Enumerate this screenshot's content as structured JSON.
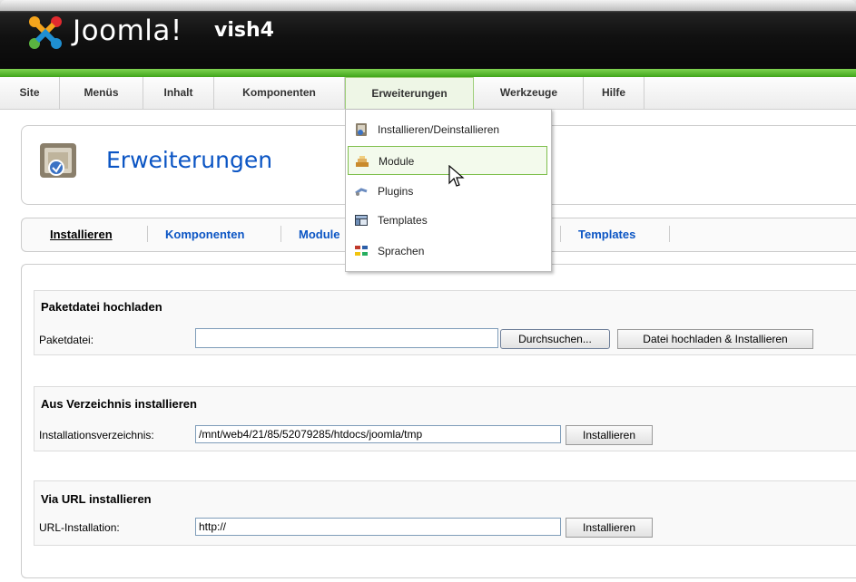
{
  "header": {
    "logo_text": "Joomla!",
    "site_name": "vish4"
  },
  "menubar": {
    "items": [
      {
        "label": "Site"
      },
      {
        "label": "Menüs"
      },
      {
        "label": "Inhalt"
      },
      {
        "label": "Komponenten"
      },
      {
        "label": "Erweiterungen"
      },
      {
        "label": "Werkzeuge"
      },
      {
        "label": "Hilfe"
      }
    ],
    "active_index": 4
  },
  "dropdown": {
    "items": [
      {
        "label": "Installieren/Deinstallieren",
        "icon": "install-icon"
      },
      {
        "label": "Module",
        "icon": "module-icon"
      },
      {
        "label": "Plugins",
        "icon": "plugin-icon"
      },
      {
        "label": "Templates",
        "icon": "template-icon"
      },
      {
        "label": "Sprachen",
        "icon": "language-icon"
      }
    ],
    "hovered_index": 1
  },
  "page": {
    "title": "Erweiterungen"
  },
  "tabs": {
    "items": [
      {
        "label": "Installieren"
      },
      {
        "label": "Komponenten"
      },
      {
        "label": "Module"
      },
      {
        "label": "Templates"
      }
    ],
    "current_index": 0
  },
  "upload": {
    "title": "Paketdatei hochladen",
    "label": "Paketdatei:",
    "value": "",
    "browse_label": "Durchsuchen...",
    "submit_label": "Datei hochladen & Installieren"
  },
  "directory": {
    "title": "Aus Verzeichnis installieren",
    "label": "Installationsverzeichnis:",
    "value": "/mnt/web4/21/85/52079285/htdocs/joomla/tmp",
    "submit_label": "Installieren"
  },
  "url": {
    "title": "Via URL installieren",
    "label": "URL-Installation:",
    "value": "http://",
    "submit_label": "Installieren"
  },
  "colors": {
    "accent_green": "#5bbd2e",
    "link_blue": "#0b55c4",
    "header_dark": "#111111"
  }
}
